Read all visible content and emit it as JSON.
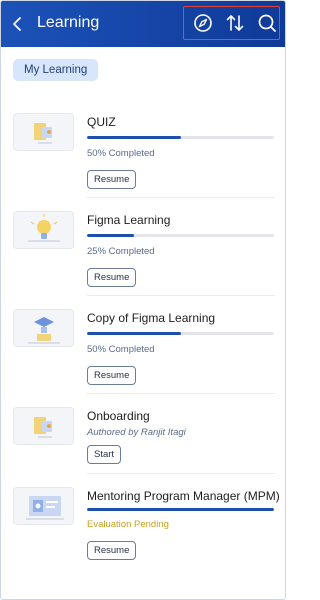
{
  "header": {
    "title": "Learning",
    "icons": [
      "back-chevron-icon",
      "compass-icon",
      "sort-icon",
      "search-icon"
    ]
  },
  "filter": {
    "label": "My Learning"
  },
  "colors": {
    "header": "#1a4db3",
    "accent": "#1c4fae",
    "pending": "#c7a11d",
    "chip": "#d7e6fb"
  },
  "courses": [
    {
      "title": "QUIZ",
      "progress": 0.5,
      "status": "50% Completed",
      "action": "Resume"
    },
    {
      "title": "Figma Learning",
      "progress": 0.25,
      "status": "25% Completed",
      "action": "Resume"
    },
    {
      "title": "Copy of Figma Learning",
      "progress": 0.5,
      "status": "50% Completed",
      "action": "Resume"
    },
    {
      "title": "Onboarding",
      "status": "Authored by Ranjit Itagi",
      "action": "Start"
    },
    {
      "title": "Mentoring Program Manager (MPM)",
      "progress": 1.0,
      "status": "Evaluation Pending",
      "action": "Resume"
    }
  ]
}
